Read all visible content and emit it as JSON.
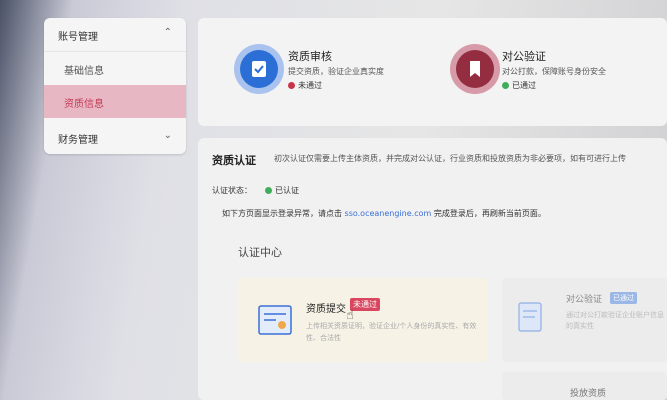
{
  "sidebar": {
    "groups": [
      {
        "label": "账号管理",
        "expanded": true,
        "items": [
          {
            "label": "基础信息",
            "active": false
          },
          {
            "label": "资质信息",
            "active": true
          }
        ]
      },
      {
        "label": "财务管理",
        "expanded": false,
        "items": []
      }
    ]
  },
  "steps": [
    {
      "title": "资质审核",
      "desc": "提交资质，验证企业真实度",
      "status": "未通过",
      "status_color": "#c8334a",
      "icon": "document-check-icon",
      "color": "#2b6fd6"
    },
    {
      "title": "对公验证",
      "desc": "对公打款，保障账号身份安全",
      "status": "已通过",
      "status_color": "#3fae5a",
      "icon": "bookmark-icon",
      "color": "#932d3f"
    }
  ],
  "main": {
    "title": "资质认证",
    "desc": "初次认证仅需要上传主体资质，并完成对公认证，行业资质和投放资质为非必要项，如有可进行上传",
    "status_label": "认证状态：",
    "status_value": "已认证",
    "notice_prefix": "如下方页面显示登录异常，请点击",
    "notice_link": "sso.oceanengine.com",
    "notice_suffix": "完成登录后，再刷新当前页面。",
    "section_title": "认证中心",
    "cards": [
      {
        "title": "资质提交",
        "badge": "未通过",
        "desc": "上传相关资质证明，验证企业/个人身份的真实性、有效性、合法性"
      },
      {
        "title": "对公验证",
        "badge": "已通过",
        "desc": "通过对公打款验证企业账户信息的真实性"
      },
      {
        "title": "投放资质"
      }
    ]
  },
  "colors": {
    "accent_pink": "#e8b7c4",
    "link_blue": "#3b6fd6",
    "badge_red": "#d9465f"
  }
}
